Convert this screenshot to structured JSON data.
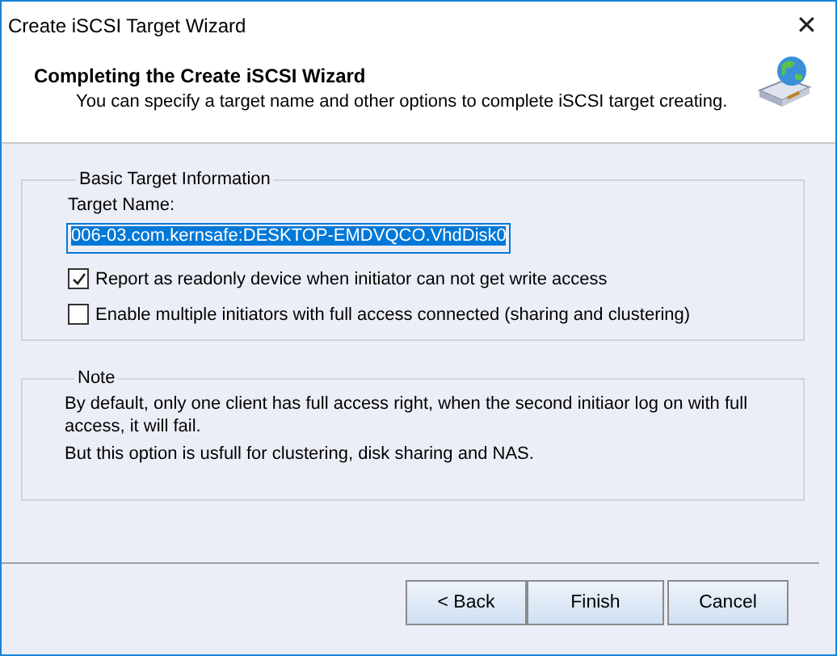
{
  "window": {
    "title": "Create iSCSI Target Wizard",
    "close": "✕"
  },
  "header": {
    "title": "Completing the Create iSCSI Wizard",
    "subtitle": "You can specify a target name and other options to complete iSCSI target creating."
  },
  "basic_group": {
    "legend": "Basic Target Information",
    "target_label": "Target Name:",
    "target_value": "006-03.com.kernsafe:DESKTOP-EMDVQCO.VhdDisk0",
    "value_selected": true,
    "options": [
      {
        "label": "Report as readonly device when initiator can not get write access",
        "checked": true
      },
      {
        "label": "Enable multiple initiators with  full access connected (sharing and clustering)",
        "checked": false
      }
    ]
  },
  "note_group": {
    "legend": "Note",
    "lines": [
      "By default, only one client has full access right, when the second initiaor log on with full access, it will fail.",
      "But this option is usfull for clustering, disk sharing and NAS."
    ]
  },
  "buttons": [
    {
      "label": "< Back",
      "kind": "back"
    },
    {
      "label": "Finish",
      "kind": "finish"
    },
    {
      "label": "Cancel",
      "kind": "cancel"
    }
  ]
}
